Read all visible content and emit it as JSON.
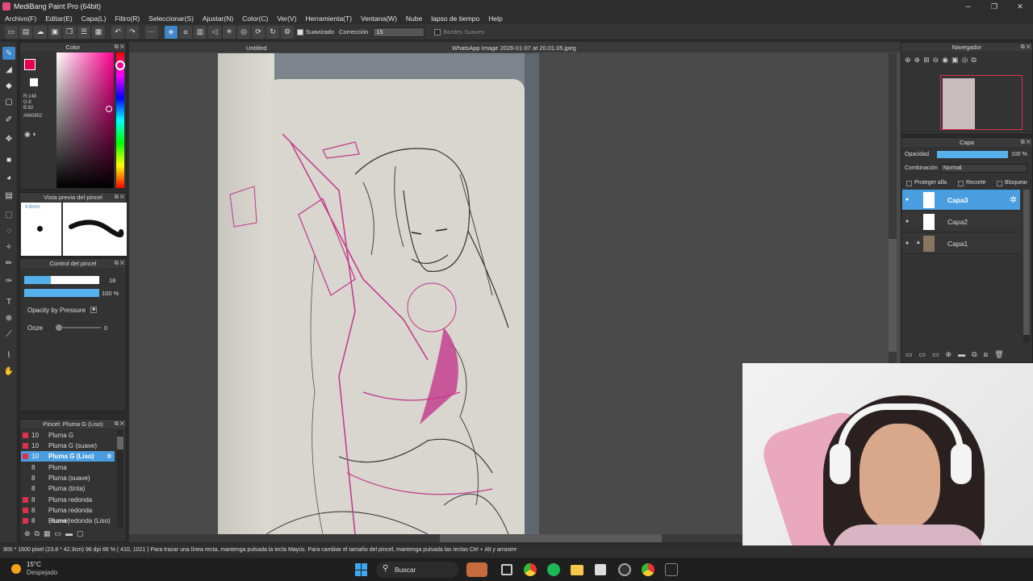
{
  "titlebar": {
    "title": "MediBang Paint Pro (64bit)",
    "minimize": "─",
    "maximize": "❐",
    "close": "✕"
  },
  "menu": [
    "Archivo(F)",
    "Editar(E)",
    "Capa(L)",
    "Filtro(R)",
    "Seleccionar(S)",
    "Ajustar(N)",
    "Color(C)",
    "Ver(V)",
    "Herramienta(T)",
    "Ventana(W)",
    "Nube",
    "lapso de tiempo",
    "Help"
  ],
  "toolbar": {
    "smoothing_label": "Suavizado",
    "correction_label": "Corrección",
    "correction_value": "15",
    "soft_edges_label": "Bordes Suaves"
  },
  "color_panel": {
    "title": "Color",
    "rgb_r": "R:148",
    "rgb_g": "G:8",
    "rgb_b": "B:82",
    "hex": "#940852",
    "fg_color": "#e5004f",
    "bg_color": "#ffffff"
  },
  "brush_preview": {
    "title": "Vista previa del pincel",
    "size": "4.8mm"
  },
  "brush_control": {
    "title": "Control del pincel",
    "size_value": "18",
    "opacity_value": "100 %",
    "pressure_label": "Opacity by Pressure",
    "ooze_label": "Ooze",
    "ooze_value": "0"
  },
  "brush_list": {
    "title": "Pincel: Pluma G (Liso)",
    "items": [
      {
        "size": "10",
        "name": "Pluma G",
        "color": "#e0304d"
      },
      {
        "size": "10",
        "name": "Pluma G (suave)",
        "color": "#e0304d"
      },
      {
        "size": "10",
        "name": "Pluma G (Liso)",
        "color": "#e0304d"
      },
      {
        "size": "8",
        "name": "Pluma",
        "color": "#333333"
      },
      {
        "size": "8",
        "name": "Pluma (suave)",
        "color": "#333333"
      },
      {
        "size": "8",
        "name": "Pluma (tinta)",
        "color": "#333333"
      },
      {
        "size": "8",
        "name": "Pluma redonda",
        "color": "#e0304d"
      },
      {
        "size": "8",
        "name": "Pluma redonda (suave)",
        "color": "#e0304d"
      },
      {
        "size": "8",
        "name": "Pluma redonda (Liso)",
        "color": "#e0304d"
      }
    ]
  },
  "document": {
    "tab_name": "Untitled",
    "image_name": "WhatsApp Image 2026-01-07 at 20.01.05.jpeg"
  },
  "navigator": {
    "title": "Navegador"
  },
  "layers": {
    "title": "Capa",
    "opacity_label": "Opacidad",
    "opacity_value": "100 %",
    "blend_label": "Combinación",
    "blend_value": "Normal",
    "protect_alpha": "Proteger alfa",
    "clip": "Recorte",
    "lock": "Bloquear",
    "items": [
      {
        "name": "Capa3"
      },
      {
        "name": "Capa2"
      },
      {
        "name": "Capa1"
      }
    ]
  },
  "statusbar": {
    "text": "900 * 1600 pixel  (23.8 * 42.3cm)  96 dpi  66 %  ( 410, 1021 )  Para trazar una línea recta, mantenga pulsada la tecla Mayús. Para cambiar el tamaño del pincel, mantenga pulsada las teclas Ctrl + Alt y arrastre"
  },
  "taskbar": {
    "weather_temp": "15°C",
    "weather_desc": "Despejado",
    "search_placeholder": "Buscar"
  }
}
